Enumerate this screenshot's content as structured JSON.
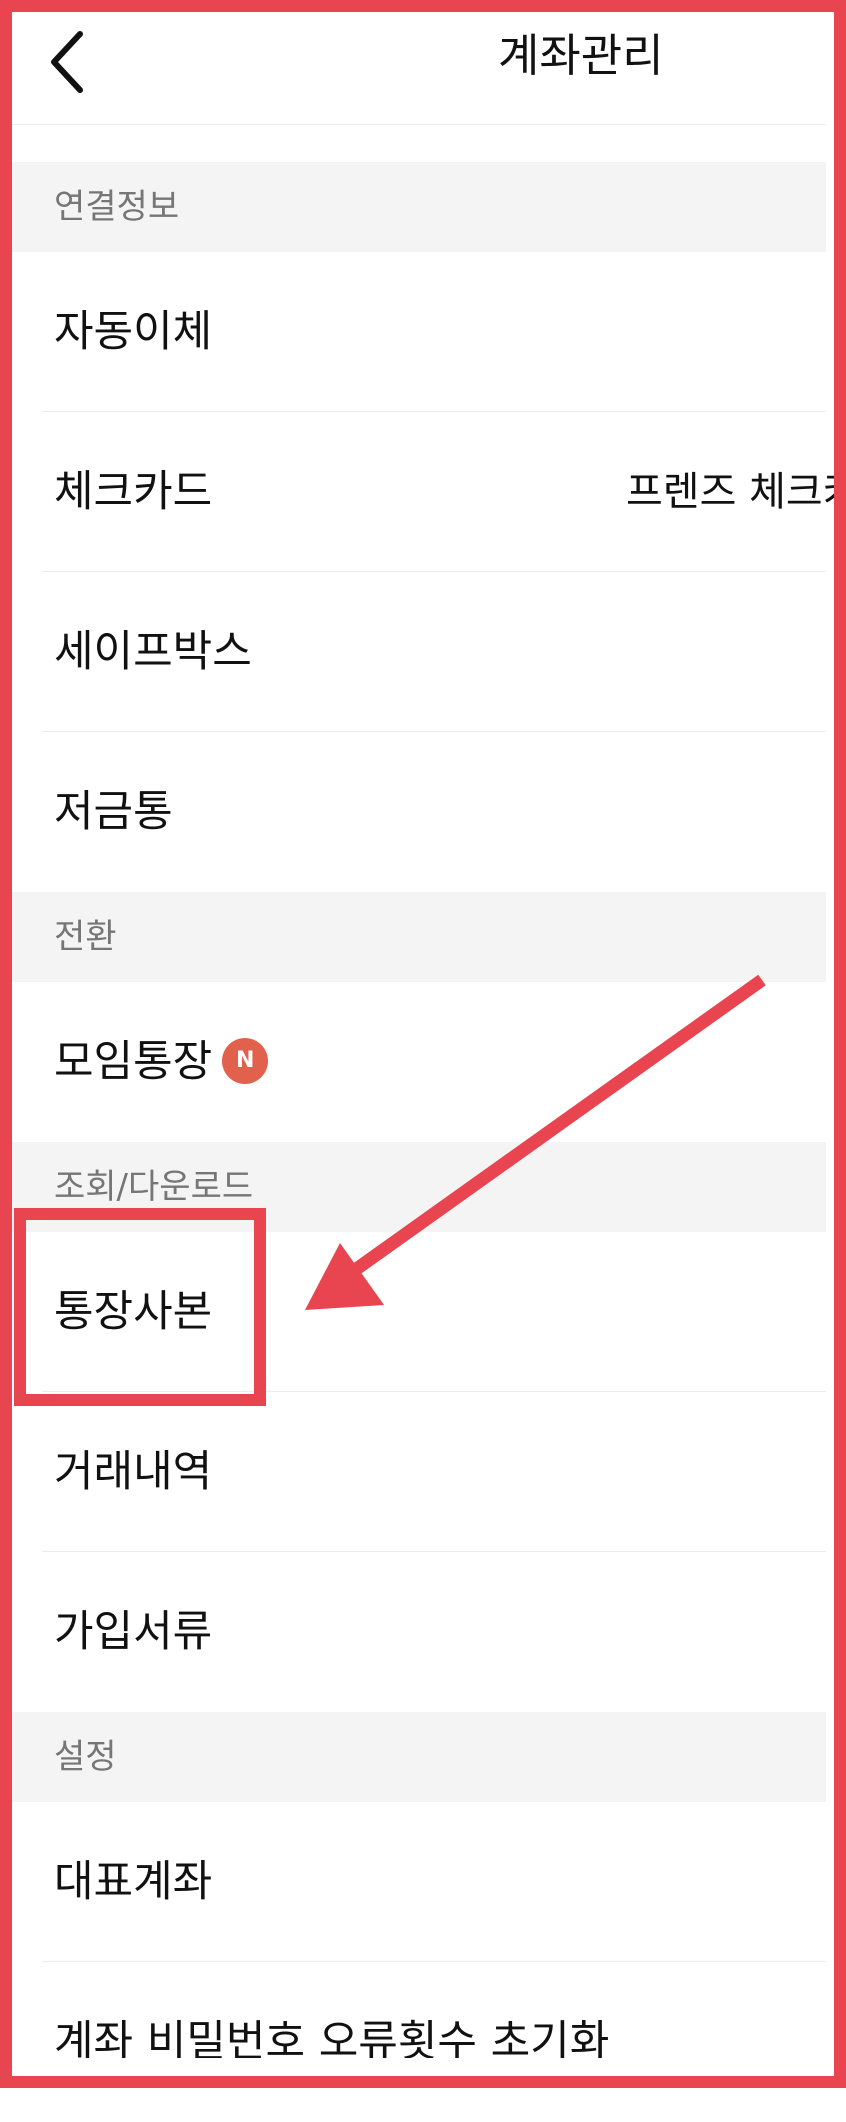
{
  "header": {
    "title": "계좌관리"
  },
  "sections": [
    {
      "label": "연결정보",
      "items": [
        {
          "label": "자동이체"
        },
        {
          "label": "체크카드",
          "detail": "프렌즈 체크카"
        },
        {
          "label": "세이프박스"
        },
        {
          "label": "저금통"
        }
      ]
    },
    {
      "label": "전환",
      "items": [
        {
          "label": "모임통장",
          "badge": "N"
        }
      ]
    },
    {
      "label": "조회/다운로드",
      "items": [
        {
          "label": "통장사본"
        },
        {
          "label": "거래내역"
        },
        {
          "label": "가입서류"
        }
      ]
    },
    {
      "label": "설정",
      "items": [
        {
          "label": "대표계좌"
        },
        {
          "label": "계좌 비밀번호 오류횟수 초기화"
        }
      ]
    }
  ],
  "annotation": {
    "color": "#e84550"
  },
  "colors": {
    "accent": "#e84550",
    "badge": "#e2614d",
    "section_bg": "#f4f4f4"
  }
}
